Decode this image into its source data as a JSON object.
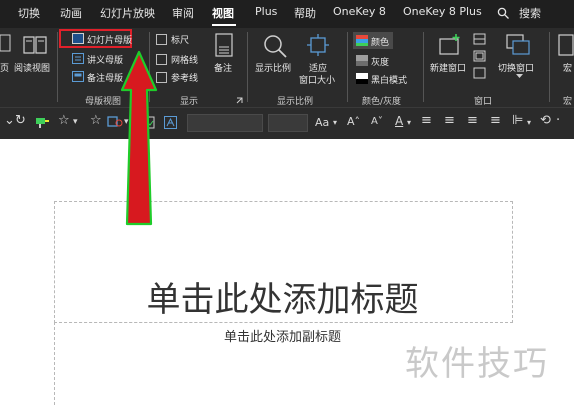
{
  "tabs": [
    {
      "label": "切换",
      "active": false
    },
    {
      "label": "动画",
      "active": false
    },
    {
      "label": "幻灯片放映",
      "active": false
    },
    {
      "label": "审阅",
      "active": false
    },
    {
      "label": "视图",
      "active": true
    },
    {
      "label": "Plus",
      "active": false
    },
    {
      "label": "帮助",
      "active": false
    },
    {
      "label": "OneKey 8",
      "active": false
    },
    {
      "label": "OneKey 8 Plus",
      "active": false
    }
  ],
  "search": {
    "label": "搜索",
    "icon": "search-icon"
  },
  "ribbon": {
    "left_partial": "页",
    "reading_view": "阅读视图",
    "master_view": {
      "slide_master": "幻灯片母版",
      "handout_master": "讲义母版",
      "notes_master": "备注母版",
      "group_label": "母版视图"
    },
    "show": {
      "ruler": "标尺",
      "gridlines": "网格线",
      "guides": "参考线",
      "group_label": "显示"
    },
    "notes": "备注",
    "zoom": {
      "zoom": "显示比例",
      "fit_line1": "适应",
      "fit_line2": "窗口大小",
      "group_label": "显示比例"
    },
    "color": {
      "color": "颜色",
      "grayscale": "灰度",
      "bw": "黑白模式",
      "group_label": "颜色/灰度"
    },
    "window": {
      "new_window": "新建窗口",
      "switch_window": "切换窗口",
      "group_label": "窗口"
    },
    "macro_partial": "宏",
    "macro_group_partial": "宏"
  },
  "toolbar": {
    "font_size_label": "Aa"
  },
  "slide": {
    "title_placeholder": "单击此处添加标题",
    "subtitle_placeholder": "单击此处添加副标题"
  },
  "watermark": "软件技巧",
  "colors": {
    "highlight_border": "#e0202a",
    "arrow_fill": "#d7191f",
    "arrow_outline": "#1fcc2a",
    "ribbon_bg": "#2b2b2b",
    "tabbar_bg": "#1f1f1f"
  }
}
